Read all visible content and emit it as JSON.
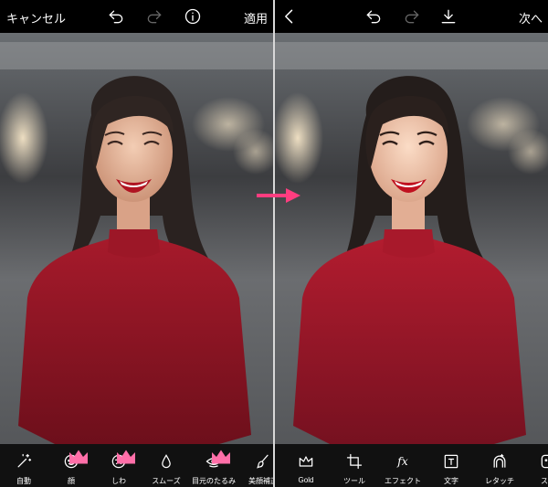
{
  "left_screen": {
    "cancel_label": "キャンセル",
    "apply_label": "適用",
    "tools": [
      {
        "label": "自動",
        "icon": "magic-wand-icon",
        "premium": false
      },
      {
        "label": "顔",
        "icon": "face-icon",
        "premium": true
      },
      {
        "label": "しわ",
        "icon": "wrinkle-face-icon",
        "premium": true
      },
      {
        "label": "スムーズ",
        "icon": "droplet-icon",
        "premium": false
      },
      {
        "label": "目元のたるみ",
        "icon": "eye-icon",
        "premium": true
      },
      {
        "label": "美顔補正",
        "icon": "brush-icon",
        "premium": false
      }
    ]
  },
  "right_screen": {
    "next_label": "次へ",
    "tools": [
      {
        "label": "Gold",
        "icon": "crown-icon"
      },
      {
        "label": "ツール",
        "icon": "crop-icon"
      },
      {
        "label": "エフェクト",
        "icon": "fx-icon"
      },
      {
        "label": "文字",
        "icon": "text-icon"
      },
      {
        "label": "レタッチ",
        "icon": "retouch-face-icon"
      },
      {
        "label": "ステ",
        "icon": "sticker-icon"
      }
    ]
  },
  "colors": {
    "accent_arrow": "#ff3d7f",
    "premium_crown": "#ff6fa8",
    "top_bar": "#000000",
    "tool_bar": "#111111"
  }
}
